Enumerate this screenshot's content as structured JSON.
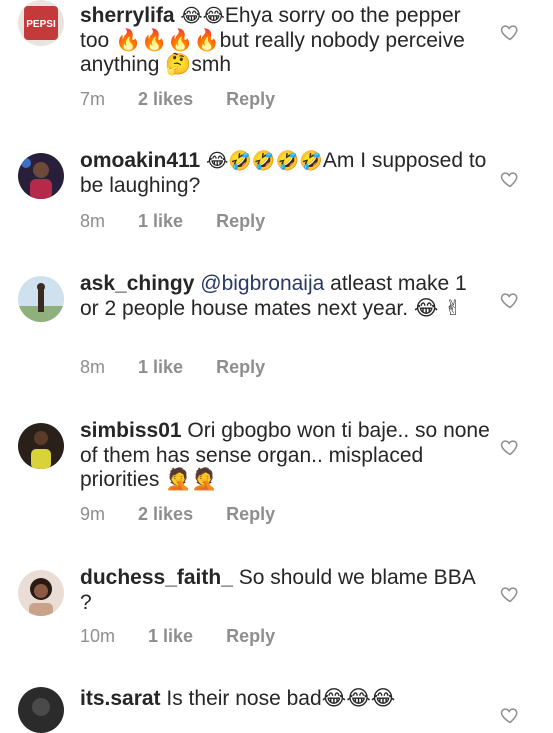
{
  "comments": [
    {
      "username": "sherrylifa",
      "emoji_lead": "😂😂",
      "text": "Ehya sorry oo the pepper too 🔥🔥🔥🔥but really nobody perceive anything 🤔smh",
      "time": "7m",
      "likes": "2 likes",
      "reply": "Reply",
      "avatar_color": "#c43a3a"
    },
    {
      "username": "omoakin411",
      "emoji_lead": "😂🤣🤣🤣🤣",
      "text": "Am I supposed to be laughing?",
      "time": "8m",
      "likes": "1 like",
      "reply": "Reply",
      "avatar_color": "#5a3b7a"
    },
    {
      "username": "ask_chingy",
      "mention": "@bigbronaija",
      "text": "atleast make 1 or 2 people house mates next year. 😂 ✌",
      "time": "8m",
      "likes": "1 like",
      "reply": "Reply",
      "avatar_color": "#7aa6c9"
    },
    {
      "username": "simbiss01",
      "text": "Ori gbogbo won ti baje.. so none of them has sense organ.. misplaced priorities 🤦🤦",
      "time": "9m",
      "likes": "2 likes",
      "reply": "Reply",
      "avatar_color": "#3a2a22"
    },
    {
      "username": "duchess_faith_",
      "text": "So should we blame BBA ?",
      "time": "10m",
      "likes": "1 like",
      "reply": "Reply",
      "avatar_color": "#4a3530"
    },
    {
      "username": "its.sarat",
      "text": "Is their nose bad😂😂😂",
      "time": "",
      "likes": "",
      "reply": "",
      "avatar_color": "#2b2b2b"
    }
  ],
  "colors": {
    "text": "#262626",
    "meta": "#8e8e8e",
    "mention": "#2a3a66"
  },
  "icons": {
    "like": "heart-outline-icon"
  }
}
